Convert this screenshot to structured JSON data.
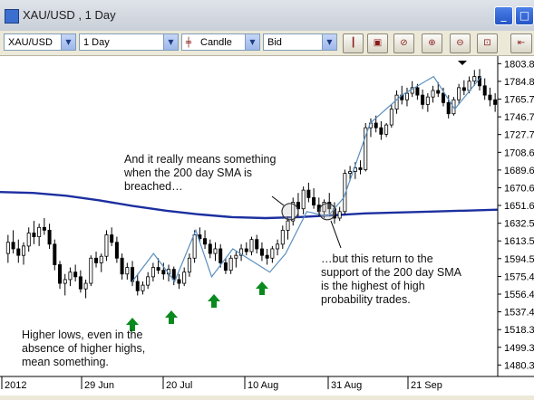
{
  "window": {
    "title": "XAU/USD , 1 Day",
    "controls": [
      "_",
      "□"
    ]
  },
  "toolbar": {
    "symbol": "XAU/USD",
    "period": "1 Day",
    "chart_type": "Candle",
    "price_type": "Bid",
    "buttons": [
      "bar-style",
      "print",
      "zoom-fit",
      "zoom-in",
      "zoom-out",
      "zoom-reset",
      "scroll-end"
    ]
  },
  "annotations": {
    "sma_breach": "And it really means something\nwhen the 200 day SMA is\nbreached…",
    "sma_return": "…but this return to the\nsupport of the 200 day SMA\nis the highest of high\nprobability trades.",
    "higher_lows": "Higher lows, even in the\nabsence of higher highs,\nmean something."
  },
  "colors": {
    "candle": "#000000",
    "sma": "#1c2fa0",
    "swing_line": "#5a8fc0",
    "arrow": "#0a8a1e",
    "background": "#ffffff",
    "grid": "#c8c8c8"
  },
  "chart_data": {
    "type": "candlestick",
    "y_ticks": [
      "1803.8",
      "1784.8",
      "1765.7",
      "1746.7",
      "1727.7",
      "1708.6",
      "1689.6",
      "1670.6",
      "1651.6",
      "1632.5",
      "1613.5",
      "1594.5",
      "1575.4",
      "1556.4",
      "1537.4",
      "1518.3",
      "1499.3",
      "1480.3"
    ],
    "x_ticks": [
      "2012",
      "29 Jun",
      "20 Jul",
      "10 Aug",
      "31 Aug",
      "21 Sep"
    ],
    "ylim": [
      1468,
      1808
    ],
    "candles": [
      [
        1600,
        1620,
        1590,
        1612
      ],
      [
        1612,
        1625,
        1600,
        1605
      ],
      [
        1605,
        1615,
        1590,
        1598
      ],
      [
        1598,
        1612,
        1588,
        1608
      ],
      [
        1608,
        1628,
        1602,
        1622
      ],
      [
        1622,
        1635,
        1610,
        1618
      ],
      [
        1618,
        1632,
        1608,
        1628
      ],
      [
        1628,
        1638,
        1620,
        1625
      ],
      [
        1625,
        1632,
        1605,
        1610
      ],
      [
        1610,
        1615,
        1582,
        1588
      ],
      [
        1588,
        1592,
        1562,
        1568
      ],
      [
        1568,
        1578,
        1555,
        1572
      ],
      [
        1572,
        1585,
        1565,
        1580
      ],
      [
        1580,
        1588,
        1570,
        1575
      ],
      [
        1575,
        1582,
        1558,
        1562
      ],
      [
        1562,
        1572,
        1552,
        1568
      ],
      [
        1568,
        1598,
        1565,
        1595
      ],
      [
        1595,
        1602,
        1585,
        1590
      ],
      [
        1590,
        1600,
        1580,
        1597
      ],
      [
        1597,
        1625,
        1592,
        1620
      ],
      [
        1620,
        1628,
        1608,
        1612
      ],
      [
        1612,
        1618,
        1590,
        1595
      ],
      [
        1595,
        1600,
        1572,
        1578
      ],
      [
        1578,
        1590,
        1572,
        1585
      ],
      [
        1585,
        1592,
        1565,
        1570
      ],
      [
        1570,
        1578,
        1555,
        1560
      ],
      [
        1560,
        1570,
        1556,
        1566
      ],
      [
        1566,
        1580,
        1562,
        1575
      ],
      [
        1575,
        1590,
        1570,
        1585
      ],
      [
        1585,
        1595,
        1578,
        1582
      ],
      [
        1582,
        1590,
        1572,
        1578
      ],
      [
        1578,
        1588,
        1570,
        1583
      ],
      [
        1583,
        1586,
        1566,
        1572
      ],
      [
        1572,
        1578,
        1562,
        1568
      ],
      [
        1568,
        1585,
        1565,
        1580
      ],
      [
        1580,
        1600,
        1575,
        1595
      ],
      [
        1595,
        1625,
        1590,
        1620
      ],
      [
        1620,
        1628,
        1612,
        1616
      ],
      [
        1616,
        1625,
        1605,
        1610
      ],
      [
        1610,
        1615,
        1595,
        1600
      ],
      [
        1600,
        1612,
        1592,
        1605
      ],
      [
        1605,
        1610,
        1585,
        1590
      ],
      [
        1590,
        1595,
        1578,
        1582
      ],
      [
        1582,
        1598,
        1578,
        1595
      ],
      [
        1595,
        1602,
        1585,
        1598
      ],
      [
        1598,
        1610,
        1592,
        1605
      ],
      [
        1605,
        1612,
        1598,
        1602
      ],
      [
        1602,
        1618,
        1598,
        1615
      ],
      [
        1615,
        1620,
        1600,
        1605
      ],
      [
        1605,
        1612,
        1592,
        1598
      ],
      [
        1598,
        1605,
        1588,
        1595
      ],
      [
        1595,
        1608,
        1590,
        1605
      ],
      [
        1605,
        1615,
        1598,
        1610
      ],
      [
        1610,
        1630,
        1605,
        1625
      ],
      [
        1625,
        1640,
        1615,
        1635
      ],
      [
        1635,
        1660,
        1630,
        1655
      ],
      [
        1655,
        1665,
        1640,
        1648
      ],
      [
        1648,
        1672,
        1642,
        1668
      ],
      [
        1668,
        1676,
        1655,
        1660
      ],
      [
        1660,
        1670,
        1648,
        1652
      ],
      [
        1652,
        1660,
        1640,
        1645
      ],
      [
        1645,
        1658,
        1638,
        1655
      ],
      [
        1655,
        1665,
        1640,
        1648
      ],
      [
        1648,
        1655,
        1632,
        1638
      ],
      [
        1638,
        1650,
        1635,
        1645
      ],
      [
        1645,
        1690,
        1642,
        1686
      ],
      [
        1686,
        1694,
        1678,
        1688
      ],
      [
        1688,
        1698,
        1680,
        1692
      ],
      [
        1692,
        1700,
        1685,
        1690
      ],
      [
        1690,
        1740,
        1688,
        1735
      ],
      [
        1735,
        1745,
        1725,
        1740
      ],
      [
        1740,
        1748,
        1730,
        1735
      ],
      [
        1735,
        1742,
        1722,
        1728
      ],
      [
        1728,
        1740,
        1725,
        1738
      ],
      [
        1738,
        1760,
        1735,
        1755
      ],
      [
        1755,
        1775,
        1750,
        1770
      ],
      [
        1770,
        1780,
        1760,
        1765
      ],
      [
        1765,
        1778,
        1758,
        1772
      ],
      [
        1772,
        1785,
        1768,
        1778
      ],
      [
        1778,
        1782,
        1765,
        1770
      ],
      [
        1770,
        1776,
        1755,
        1760
      ],
      [
        1760,
        1772,
        1752,
        1768
      ],
      [
        1768,
        1780,
        1762,
        1775
      ],
      [
        1775,
        1784,
        1768,
        1772
      ],
      [
        1772,
        1778,
        1758,
        1762
      ],
      [
        1762,
        1770,
        1745,
        1750
      ],
      [
        1750,
        1768,
        1748,
        1765
      ],
      [
        1765,
        1782,
        1760,
        1778
      ],
      [
        1778,
        1786,
        1770,
        1775
      ],
      [
        1775,
        1790,
        1772,
        1785
      ],
      [
        1785,
        1797,
        1780,
        1790
      ],
      [
        1790,
        1798,
        1775,
        1780
      ],
      [
        1780,
        1788,
        1765,
        1770
      ],
      [
        1770,
        1778,
        1758,
        1765
      ],
      [
        1765,
        1772,
        1752,
        1760
      ]
    ],
    "sma_200": [
      [
        0,
        1666
      ],
      [
        10,
        1665
      ],
      [
        20,
        1662
      ],
      [
        30,
        1657
      ],
      [
        40,
        1651
      ],
      [
        50,
        1646
      ],
      [
        60,
        1642
      ],
      [
        70,
        1639
      ],
      [
        80,
        1638
      ],
      [
        90,
        1639
      ],
      [
        100,
        1641
      ],
      [
        110,
        1643
      ],
      [
        120,
        1644
      ],
      [
        130,
        1645
      ],
      [
        140,
        1646
      ],
      [
        150,
        1647
      ]
    ],
    "swing_line": [
      1570,
      1600,
      1570,
      1625,
      1575,
      1605,
      1580,
      1600,
      1645,
      1640,
      1660,
      1740,
      1770,
      1790,
      1755,
      1790
    ],
    "highlight_circles": [
      [
        53,
        1645
      ],
      [
        64,
        1645
      ]
    ],
    "arrows_candle_index": [
      20,
      30,
      41,
      52
    ]
  }
}
